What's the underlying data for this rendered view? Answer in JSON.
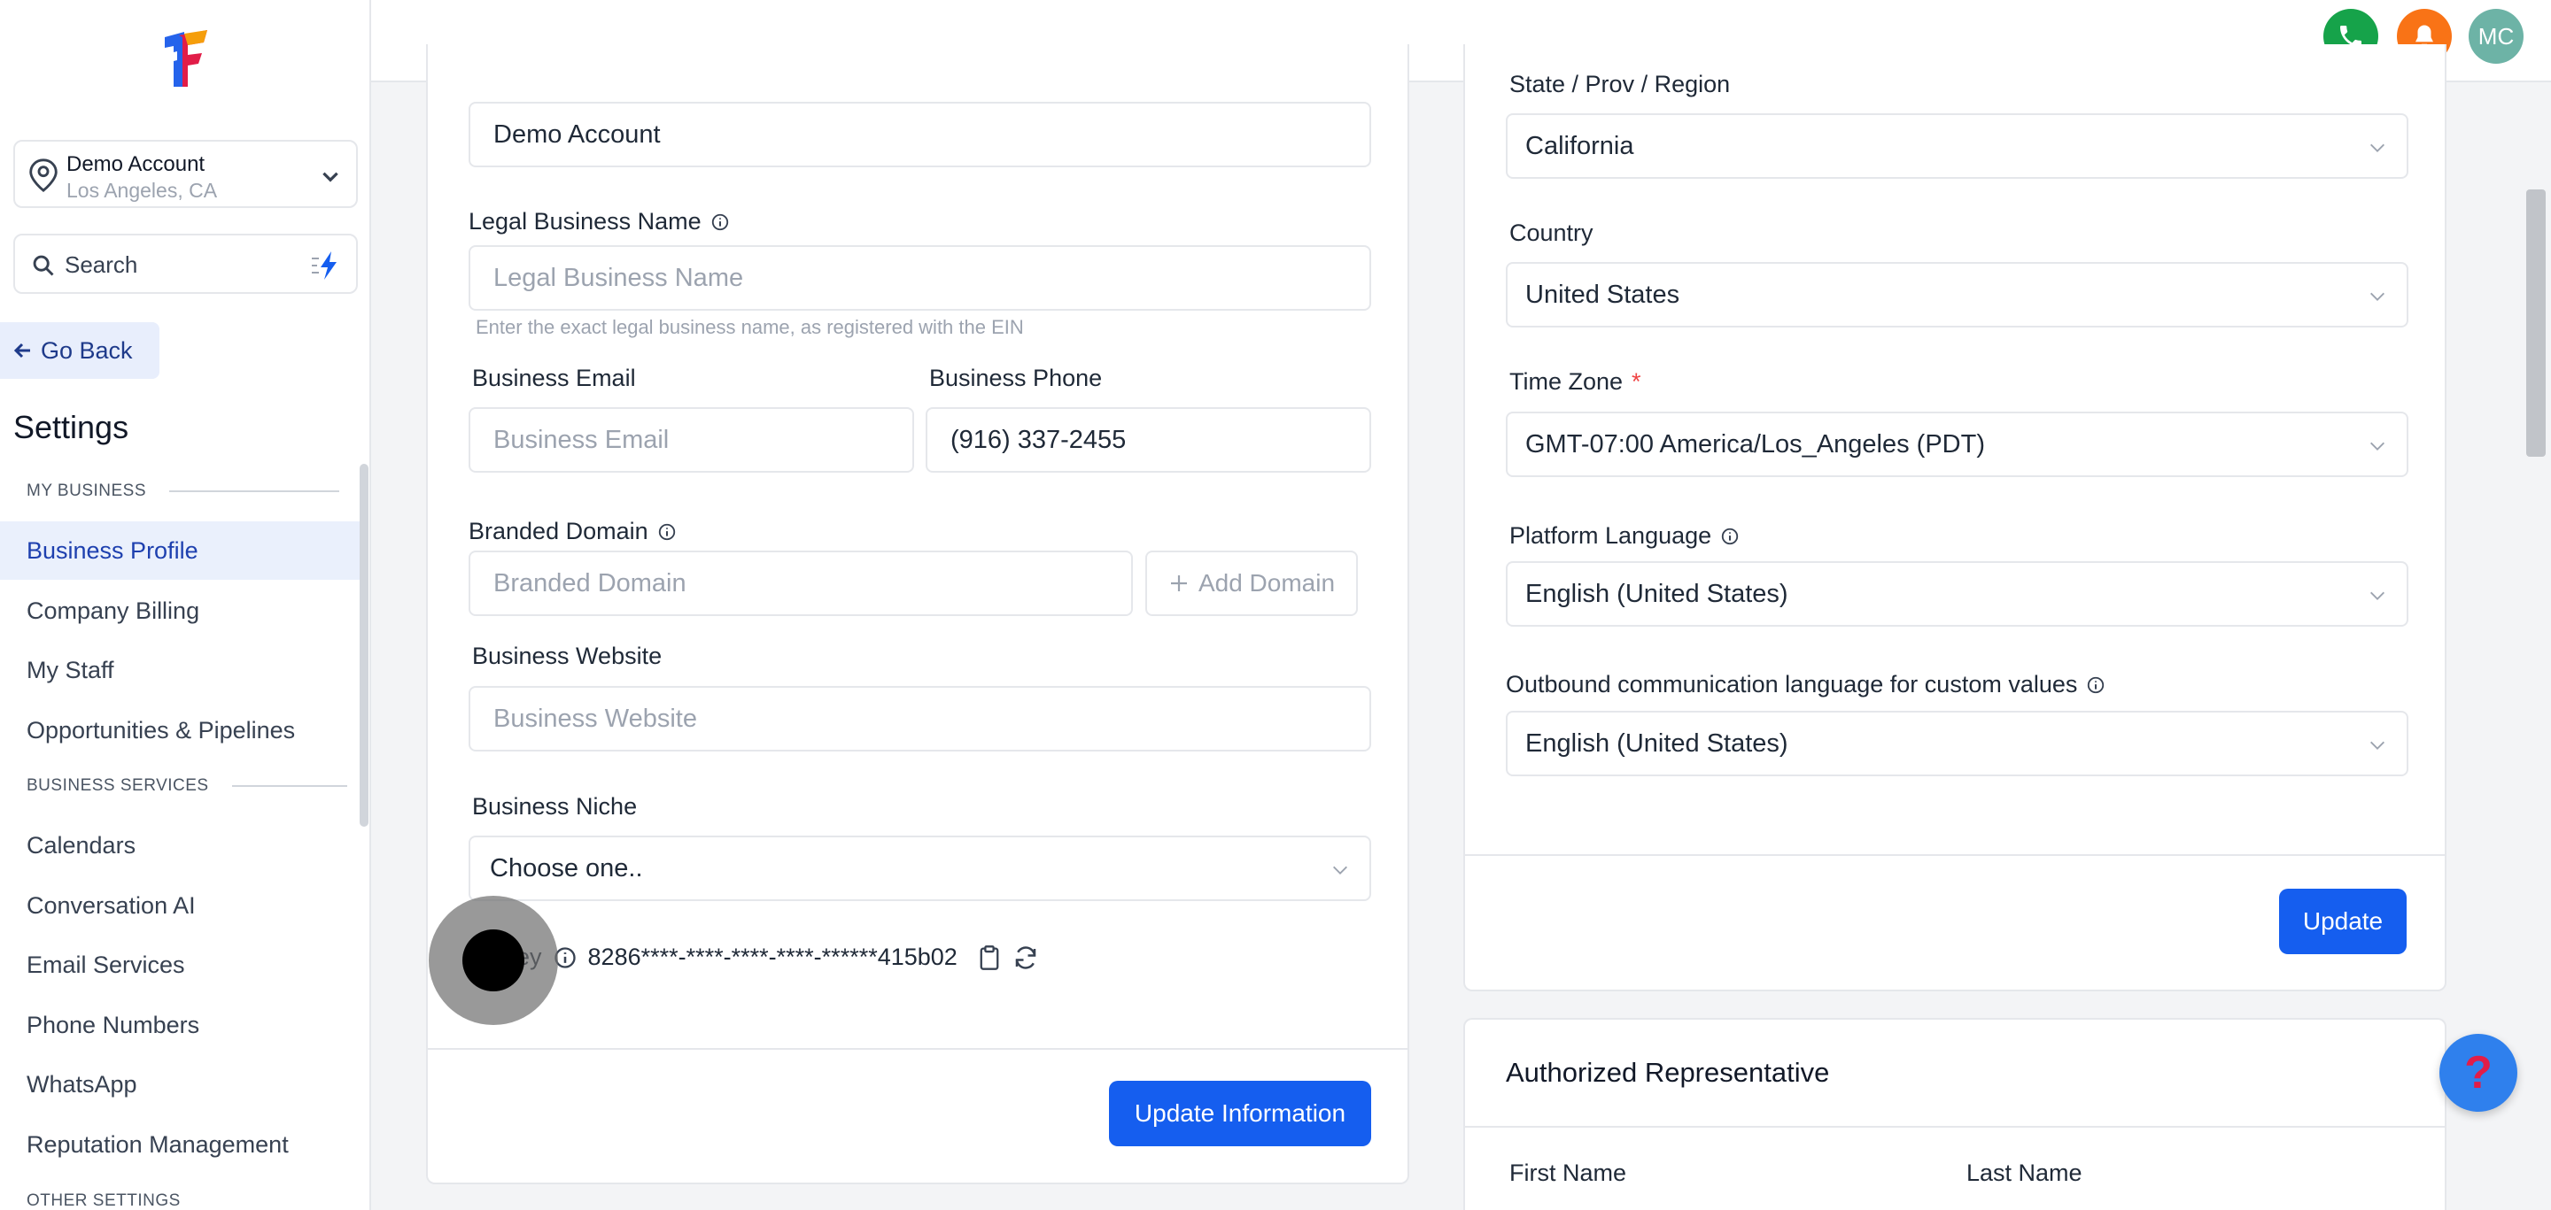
{
  "account": {
    "name": "Demo Account",
    "location": "Los Angeles, CA"
  },
  "search": {
    "label": "Search"
  },
  "nav": {
    "go_back": "Go Back",
    "settings_title": "Settings",
    "section_my_business": "MY BUSINESS",
    "section_business_services": "BUSINESS SERVICES",
    "section_other_settings": "OTHER SETTINGS",
    "items_my_business": [
      "Business Profile",
      "Company Billing",
      "My Staff",
      "Opportunities & Pipelines"
    ],
    "items_services": [
      "Calendars",
      "Conversation AI",
      "Email Services",
      "Phone Numbers",
      "WhatsApp",
      "Reputation Management"
    ],
    "active": "Business Profile"
  },
  "topbar": {
    "avatar_initials": "MC",
    "colors": {
      "phone": "#16a34a",
      "bell": "#f97316",
      "avatar": "#6db3a6"
    }
  },
  "general_form": {
    "friendly_name_value": "Demo Account",
    "legal_name_label": "Legal Business Name",
    "legal_name_placeholder": "Legal Business Name",
    "legal_name_hint": "Enter the exact legal business name, as registered with the EIN",
    "email_label": "Business Email",
    "email_placeholder": "Business Email",
    "phone_label": "Business Phone",
    "phone_value": "(916) 337-2455",
    "domain_label": "Branded Domain",
    "domain_placeholder": "Branded Domain",
    "add_domain": "Add Domain",
    "website_label": "Business Website",
    "website_placeholder": "Business Website",
    "niche_label": "Business Niche",
    "niche_value": "Choose one..",
    "api_key_label_partial": "ey",
    "api_key_value": "8286****-****-****-****-******415b02",
    "update_button": "Update Information"
  },
  "address_form": {
    "state_label": "State / Prov / Region",
    "state_value": "California",
    "country_label": "Country",
    "country_value": "United States",
    "timezone_label": "Time Zone",
    "timezone_required": "*",
    "timezone_value": "GMT-07:00 America/Los_Angeles (PDT)",
    "platform_lang_label": "Platform Language",
    "platform_lang_value": "English (United States)",
    "outbound_lang_label": "Outbound communication language for custom values",
    "outbound_lang_value": "English (United States)",
    "update_button": "Update"
  },
  "authorized_rep": {
    "title": "Authorized Representative",
    "first_name_label": "First Name",
    "last_name_label": "Last Name"
  },
  "help_button": {
    "glyph": "?"
  },
  "accent_color": "#155eef"
}
